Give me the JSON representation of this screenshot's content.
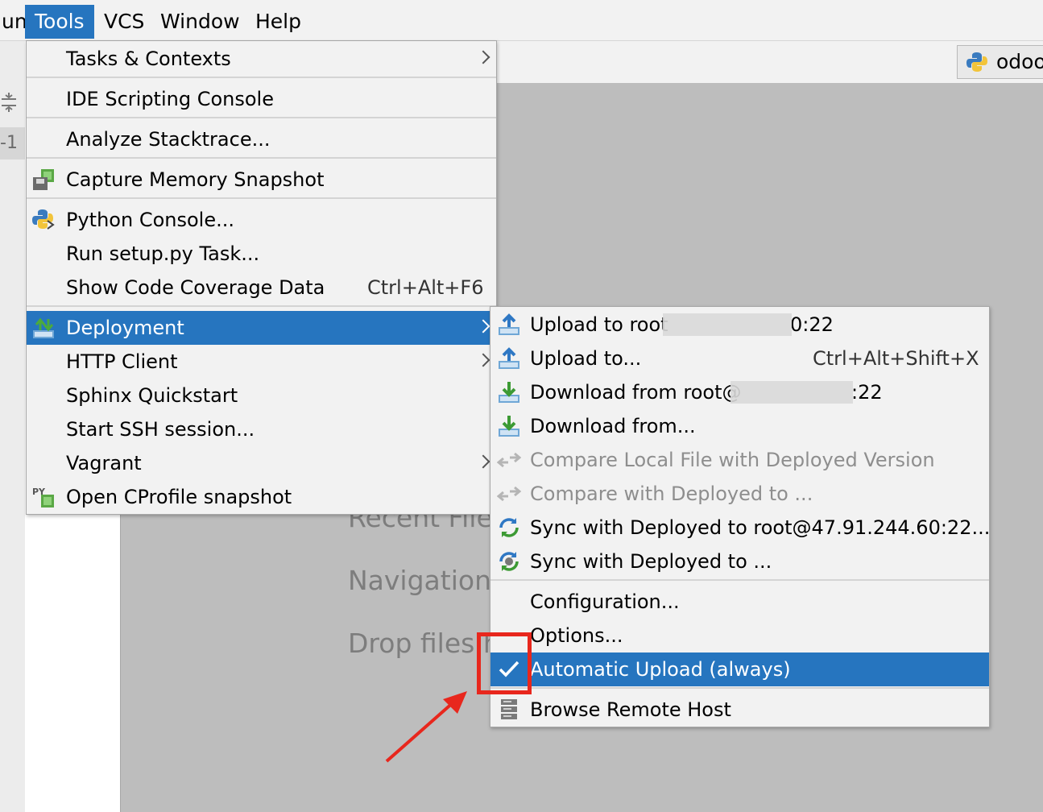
{
  "menubar": {
    "items": [
      {
        "label": "un",
        "active": false
      },
      {
        "label": "Tools",
        "active": true
      },
      {
        "label": "VCS",
        "active": false
      },
      {
        "label": "Window",
        "active": false
      },
      {
        "label": "Help",
        "active": false
      }
    ]
  },
  "left_panel": {
    "tab_label": "-1"
  },
  "toolbar": {
    "run_config": {
      "label": "odoo",
      "icon": "python-icon"
    }
  },
  "editor_hints": {
    "recent_files": "Recent Files",
    "navigation": "Navigation",
    "drop_files": "Drop files h"
  },
  "tools_menu": {
    "items": [
      {
        "label": "Tasks & Contexts",
        "submenu": true
      },
      {
        "label": "IDE Scripting Console"
      },
      {
        "label": "Analyze Stacktrace..."
      },
      {
        "label": "Capture Memory Snapshot",
        "icon": "memory-snapshot-icon"
      },
      {
        "label": "Python Console...",
        "icon": "python-console-icon"
      },
      {
        "label": "Run setup.py Task..."
      },
      {
        "label": "Show Code Coverage Data",
        "shortcut": "Ctrl+Alt+F6"
      },
      {
        "label": "Deployment",
        "submenu": true,
        "selected": true,
        "icon": "deployment-icon"
      },
      {
        "label": "HTTP Client",
        "submenu": true
      },
      {
        "label": "Sphinx Quickstart"
      },
      {
        "label": "Start SSH session..."
      },
      {
        "label": "Vagrant",
        "submenu": true
      },
      {
        "label": "Open CProfile snapshot",
        "icon": "cprofile-icon"
      }
    ]
  },
  "deployment_menu": {
    "items": [
      {
        "label": "Upload to root",
        "suffix": "0:22",
        "icon": "upload-icon"
      },
      {
        "label": "Upload to...",
        "shortcut": "Ctrl+Alt+Shift+X",
        "icon": "upload-to-icon"
      },
      {
        "label": "Download from root@",
        "suffix": ":22",
        "icon": "download-icon"
      },
      {
        "label": "Download from...",
        "icon": "download-from-icon"
      },
      {
        "label": "Compare Local File with Deployed Version",
        "disabled": true,
        "icon": "compare-icon"
      },
      {
        "label": "Compare with Deployed to ...",
        "disabled": true,
        "icon": "compare-to-icon"
      },
      {
        "label": "Sync with Deployed to root@47.91.244.60:22...",
        "icon": "sync-icon"
      },
      {
        "label": "Sync with Deployed to ...",
        "icon": "sync-to-icon"
      },
      {
        "label": "Configuration..."
      },
      {
        "label": "Options..."
      },
      {
        "label": "Automatic Upload (always)",
        "checked": true,
        "selected": true,
        "icon": "checkmark-icon"
      },
      {
        "label": "Browse Remote Host",
        "icon": "remote-host-icon"
      }
    ]
  },
  "annotation": {
    "color": "#e8271d"
  }
}
